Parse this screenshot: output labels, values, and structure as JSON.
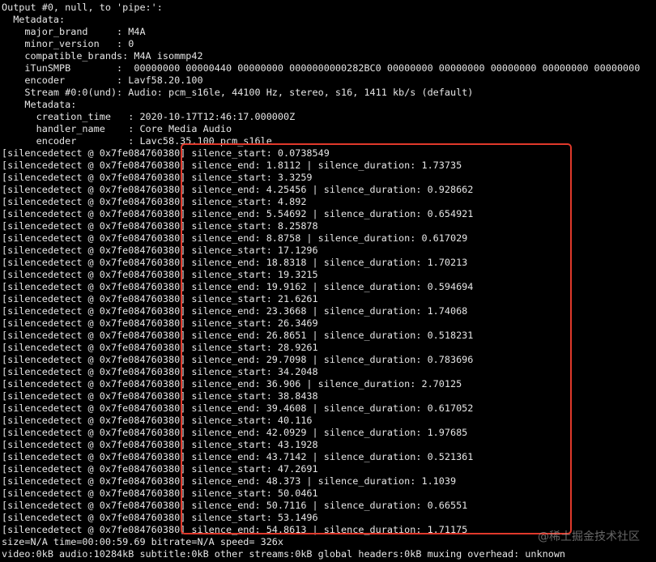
{
  "terminal": {
    "lines": [
      "Output #0, null, to 'pipe:':",
      "  Metadata:",
      "    major_brand     : M4A",
      "    minor_version   : 0",
      "    compatible_brands: M4A isommp42",
      "    iTunSMPB        :  00000000 00000440 00000000 0000000000282BC0 00000000 00000000 00000000 00000000 00000000",
      "    encoder         : Lavf58.20.100",
      "    Stream #0:0(und): Audio: pcm_s16le, 44100 Hz, stereo, s16, 1411 kb/s (default)",
      "    Metadata:",
      "      creation_time   : 2020-10-17T12:46:17.000000Z",
      "      handler_name    : Core Media Audio",
      "      encoder         : Lavc58.35.100 pcm_s16le",
      "[silencedetect @ 0x7fe084760380] silence_start: 0.0738549",
      "[silencedetect @ 0x7fe084760380] silence_end: 1.8112 | silence_duration: 1.73735",
      "[silencedetect @ 0x7fe084760380] silence_start: 3.3259",
      "[silencedetect @ 0x7fe084760380] silence_end: 4.25456 | silence_duration: 0.928662",
      "[silencedetect @ 0x7fe084760380] silence_start: 4.892",
      "[silencedetect @ 0x7fe084760380] silence_end: 5.54692 | silence_duration: 0.654921",
      "[silencedetect @ 0x7fe084760380] silence_start: 8.25878",
      "[silencedetect @ 0x7fe084760380] silence_end: 8.8758 | silence_duration: 0.617029",
      "[silencedetect @ 0x7fe084760380] silence_start: 17.1296",
      "[silencedetect @ 0x7fe084760380] silence_end: 18.8318 | silence_duration: 1.70213",
      "[silencedetect @ 0x7fe084760380] silence_start: 19.3215",
      "[silencedetect @ 0x7fe084760380] silence_end: 19.9162 | silence_duration: 0.594694",
      "[silencedetect @ 0x7fe084760380] silence_start: 21.6261",
      "[silencedetect @ 0x7fe084760380] silence_end: 23.3668 | silence_duration: 1.74068",
      "[silencedetect @ 0x7fe084760380] silence_start: 26.3469",
      "[silencedetect @ 0x7fe084760380] silence_end: 26.8651 | silence_duration: 0.518231",
      "[silencedetect @ 0x7fe084760380] silence_start: 28.9261",
      "[silencedetect @ 0x7fe084760380] silence_end: 29.7098 | silence_duration: 0.783696",
      "[silencedetect @ 0x7fe084760380] silence_start: 34.2048",
      "[silencedetect @ 0x7fe084760380] silence_end: 36.906 | silence_duration: 2.70125",
      "[silencedetect @ 0x7fe084760380] silence_start: 38.8438",
      "[silencedetect @ 0x7fe084760380] silence_end: 39.4608 | silence_duration: 0.617052",
      "[silencedetect @ 0x7fe084760380] silence_start: 40.116",
      "[silencedetect @ 0x7fe084760380] silence_end: 42.0929 | silence_duration: 1.97685",
      "[silencedetect @ 0x7fe084760380] silence_start: 43.1928",
      "[silencedetect @ 0x7fe084760380] silence_end: 43.7142 | silence_duration: 0.521361",
      "[silencedetect @ 0x7fe084760380] silence_start: 47.2691",
      "[silencedetect @ 0x7fe084760380] silence_end: 48.373 | silence_duration: 1.1039",
      "[silencedetect @ 0x7fe084760380] silence_start: 50.0461",
      "[silencedetect @ 0x7fe084760380] silence_end: 50.7116 | silence_duration: 0.66551",
      "[silencedetect @ 0x7fe084760380] silence_start: 53.1496",
      "[silencedetect @ 0x7fe084760380] silence_end: 54.8613 | silence_duration: 1.71175",
      "size=N/A time=00:00:59.69 bitrate=N/A speed= 326x",
      "video:0kB audio:10284kB subtitle:0kB other streams:0kB global headers:0kB muxing overhead: unknown"
    ]
  },
  "watermark": {
    "text": "@稀土掘金技术社区"
  },
  "colors": {
    "background": "#000000",
    "foreground": "#e6e6e6",
    "highlight_border": "#e0392b"
  }
}
